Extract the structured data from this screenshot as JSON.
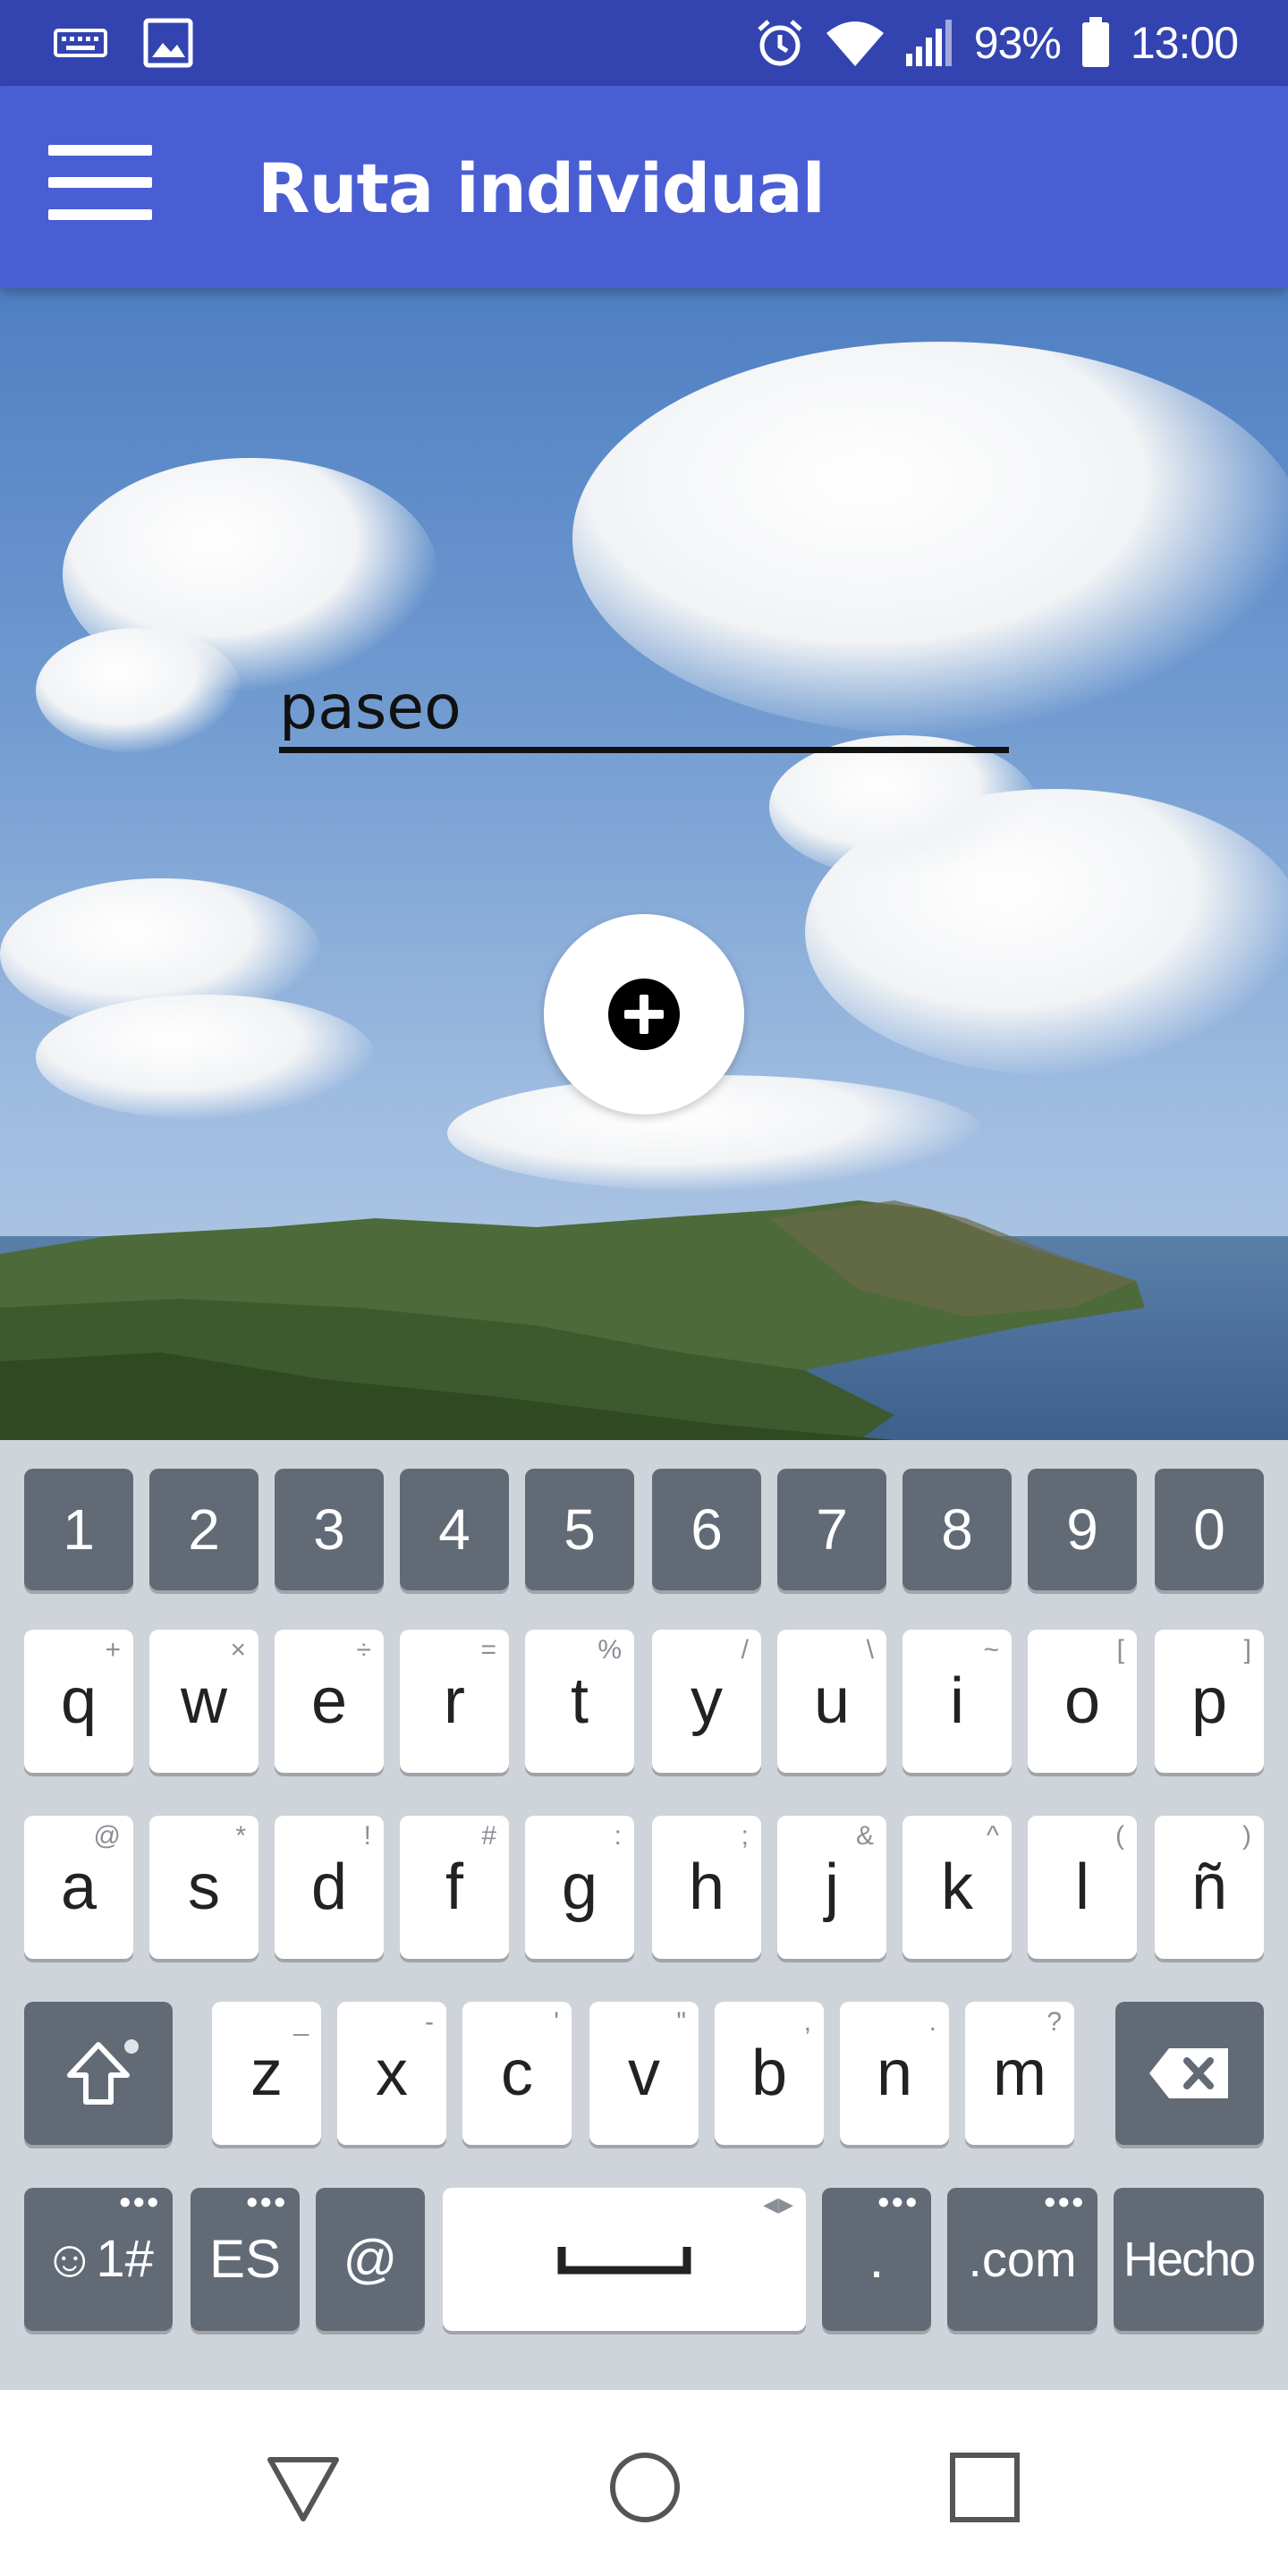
{
  "status_bar": {
    "battery": "93%",
    "time": "13:00"
  },
  "app_bar": {
    "title": "Ruta individual"
  },
  "form": {
    "route_name_value": "paseo"
  },
  "keyboard": {
    "number_row": [
      "1",
      "2",
      "3",
      "4",
      "5",
      "6",
      "7",
      "8",
      "9",
      "0"
    ],
    "row1": [
      {
        "key": "q",
        "sup": "+"
      },
      {
        "key": "w",
        "sup": "×"
      },
      {
        "key": "e",
        "sup": "÷"
      },
      {
        "key": "r",
        "sup": "="
      },
      {
        "key": "t",
        "sup": "%"
      },
      {
        "key": "y",
        "sup": "/"
      },
      {
        "key": "u",
        "sup": "\\"
      },
      {
        "key": "i",
        "sup": "~"
      },
      {
        "key": "o",
        "sup": "["
      },
      {
        "key": "p",
        "sup": "]"
      }
    ],
    "row2": [
      {
        "key": "a",
        "sup": "@"
      },
      {
        "key": "s",
        "sup": "*"
      },
      {
        "key": "d",
        "sup": "!"
      },
      {
        "key": "f",
        "sup": "#"
      },
      {
        "key": "g",
        "sup": ":"
      },
      {
        "key": "h",
        "sup": ";"
      },
      {
        "key": "j",
        "sup": "&"
      },
      {
        "key": "k",
        "sup": "^"
      },
      {
        "key": "l",
        "sup": "("
      },
      {
        "key": "ñ",
        "sup": ")"
      }
    ],
    "row3": [
      {
        "key": "z",
        "sup": "_"
      },
      {
        "key": "x",
        "sup": "-"
      },
      {
        "key": "c",
        "sup": "'"
      },
      {
        "key": "v",
        "sup": "\""
      },
      {
        "key": "b",
        "sup": ","
      },
      {
        "key": "n",
        "sup": "."
      },
      {
        "key": "m",
        "sup": "?"
      }
    ],
    "bottom": {
      "symbols": "☺1#",
      "language": "ES",
      "at": "@",
      "period": ".",
      "dotcom": ".com",
      "done": "Hecho"
    }
  },
  "colors": {
    "status_bar": "#3344b0",
    "app_bar": "#4a5ed4",
    "keyboard_bg": "#cfd3da",
    "key_dark": "#626a76"
  }
}
